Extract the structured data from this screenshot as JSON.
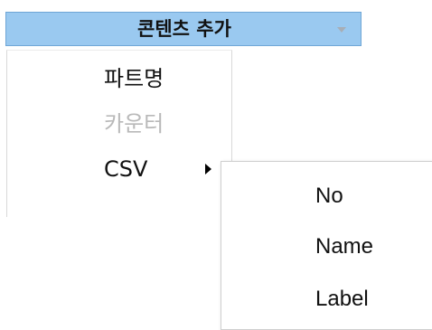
{
  "header": {
    "title": "콘텐츠 추가",
    "arrow_icon": "chevron-down-icon",
    "background": "#9ac9f0"
  },
  "menu": {
    "items": [
      {
        "label": "파트명",
        "disabled": false
      },
      {
        "label": "카운터",
        "disabled": true
      },
      {
        "label": "CSV",
        "disabled": false,
        "has_submenu": true
      }
    ]
  },
  "submenu": {
    "items": [
      {
        "label": "No"
      },
      {
        "label": "Name"
      },
      {
        "label": "Label"
      }
    ]
  }
}
